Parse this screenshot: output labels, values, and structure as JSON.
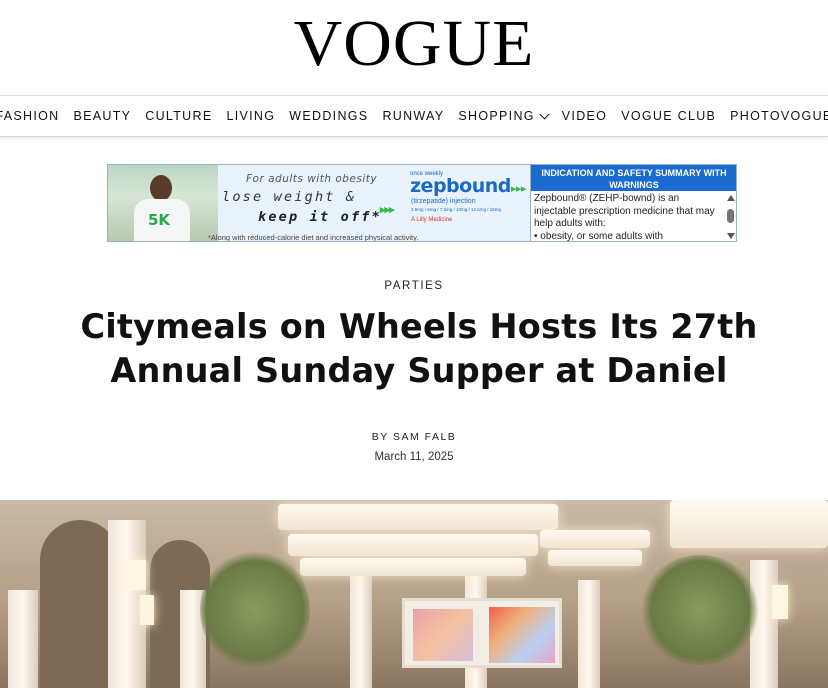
{
  "brand": {
    "logo_text": "VOGUE"
  },
  "nav": {
    "items": [
      {
        "label": "FASHION"
      },
      {
        "label": "BEAUTY"
      },
      {
        "label": "CULTURE"
      },
      {
        "label": "LIVING"
      },
      {
        "label": "WEDDINGS"
      },
      {
        "label": "RUNWAY"
      },
      {
        "label": "SHOPPING",
        "has_dropdown": true
      },
      {
        "label": "VIDEO"
      },
      {
        "label": "VOGUE CLUB"
      },
      {
        "label": "PHOTOVOGUE"
      }
    ]
  },
  "ad": {
    "tagline_small": "For adults with obesity",
    "tagline_line1": "lose weight &",
    "tagline_line2": "keep it off*",
    "fine_print": "*Along with reduced-calorie diet and increased physical activity.",
    "shirt_text": "5K",
    "arrows": "▸▸▸",
    "once_weekly": "once weekly",
    "product_name": "zepbound",
    "product_arrows": "▸▸▸",
    "product_generic": "(tirzepatide) injection",
    "product_doses": "2.5mg / 5mg / 7.5mg / 10mg / 12.5mg / 15mg",
    "manufacturer": "A Lilly Medicine",
    "isi_header": "INDICATION AND SAFETY SUMMARY WITH WARNINGS",
    "isi_text": "Zepbound® (ZEHP-bownd) is an injectable prescription medicine that may help adults with:",
    "isi_bullet": "• obesity, or some adults with"
  },
  "article": {
    "rubric": "PARTIES",
    "headline": "Citymeals on Wheels Hosts Its 27th Annual Sunday Supper at Daniel",
    "byline_prefix": "BY",
    "author": "SAM FALB",
    "date": "March 11, 2025"
  },
  "colors": {
    "nav_border": "#d9d9d9",
    "ad_brand_blue": "#1d69c8",
    "ad_green": "#3bb54a",
    "isi_header_bg": "#1a6bd0"
  }
}
